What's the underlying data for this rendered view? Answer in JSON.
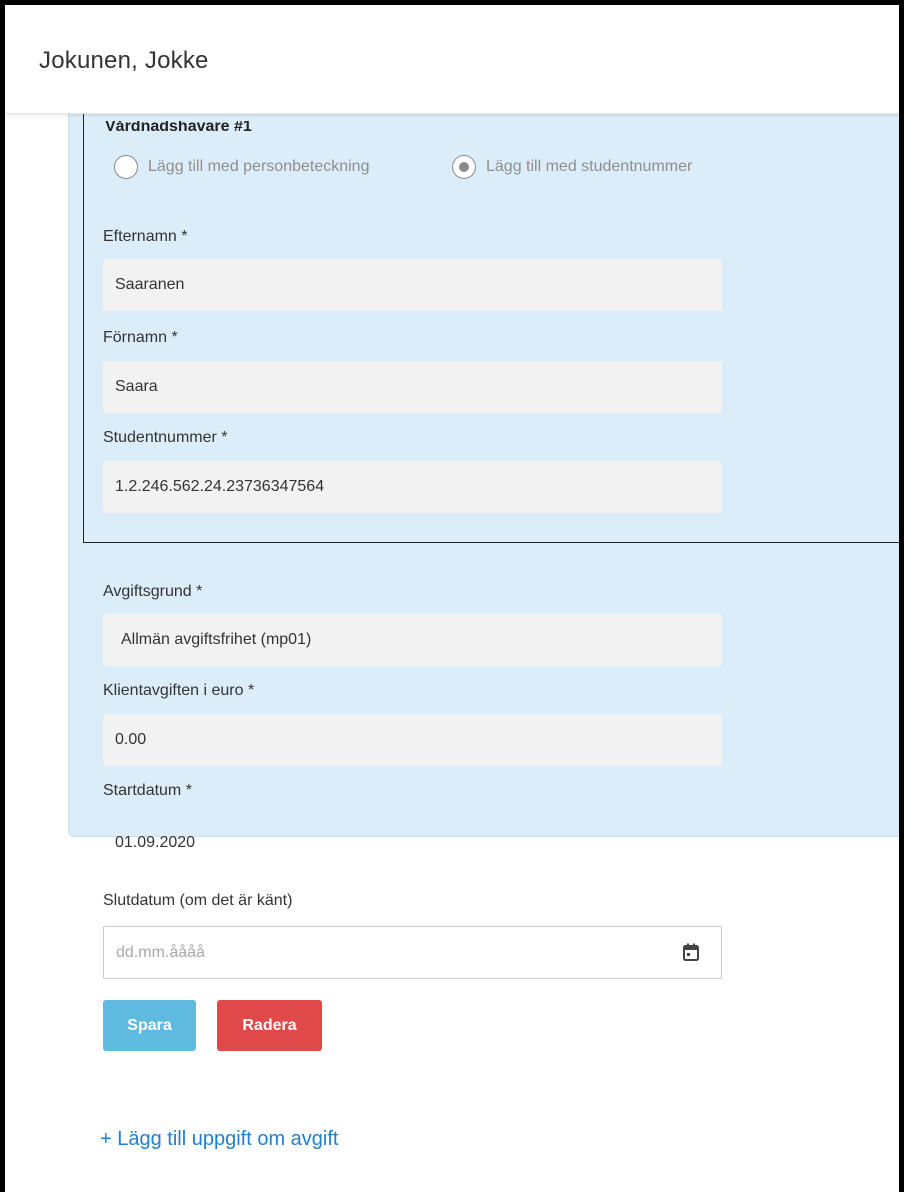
{
  "header": {
    "title": "Jokunen, Jokke"
  },
  "guardian": {
    "title": "Vårdnadshavare #1",
    "radio_options": [
      {
        "label": "Lägg till med personbeteckning",
        "checked": false
      },
      {
        "label": "Lägg till med studentnummer",
        "checked": true
      }
    ],
    "lastname_label": "Efternamn *",
    "lastname_value": "Saaranen",
    "firstname_label": "Förnamn *",
    "firstname_value": "Saara",
    "studentnumber_label": "Studentnummer *",
    "studentnumber_value": "1.2.246.562.24.23736347564"
  },
  "fee": {
    "basis_label": "Avgiftsgrund *",
    "basis_value": "Allmän avgiftsfrihet (mp01)",
    "amount_label": "Klientavgiften i euro *",
    "amount_value": "0.00",
    "start_label": "Startdatum *",
    "start_value": "01.09.2020",
    "end_label": "Slutdatum (om det är känt)",
    "end_placeholder": "dd.mm.åååå"
  },
  "buttons": {
    "save": "Spara",
    "delete": "Radera"
  },
  "add_link": "+ Lägg till uppgift om avgift",
  "colors": {
    "panel_bg": "#dcedfa",
    "save_button": "#5fbadf",
    "delete_button": "#e0494a",
    "link": "#1f7fd0"
  },
  "icons": {
    "date_picker": "calendar-icon"
  }
}
